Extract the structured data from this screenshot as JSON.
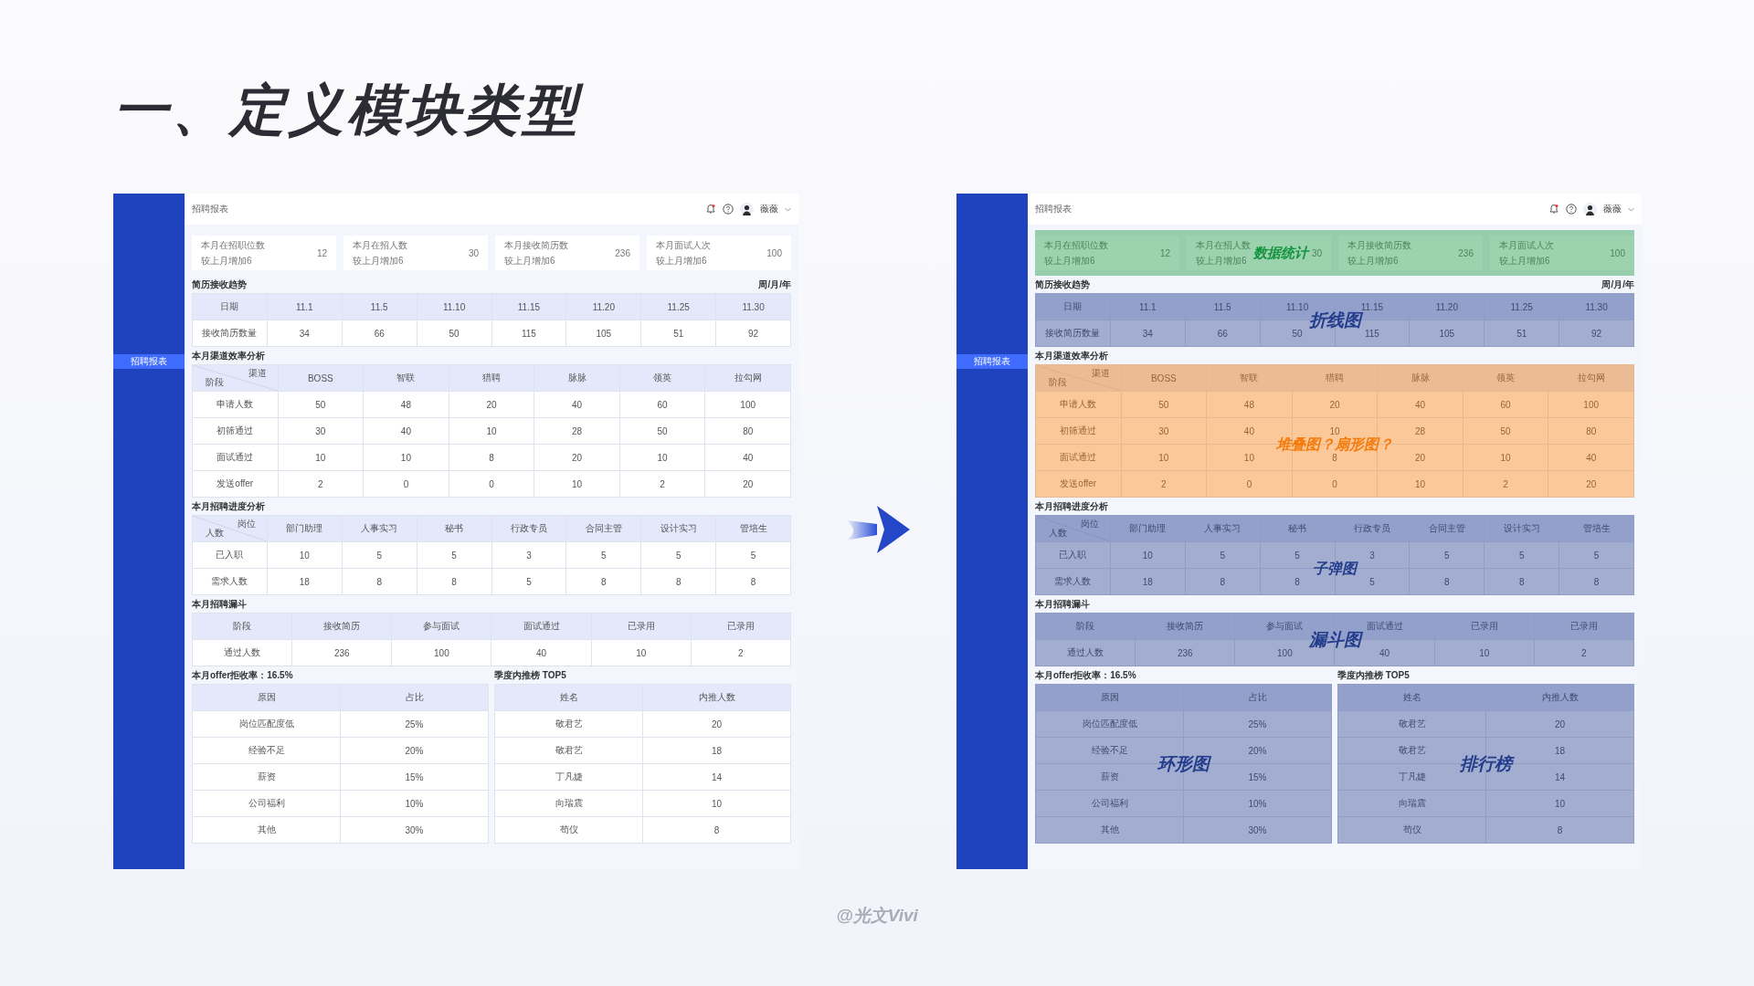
{
  "slide_title": "一、定义模块类型",
  "dashboards": [
    {
      "header": {
        "title": "招聘报表",
        "user": "薇薇"
      },
      "sidebar": {
        "items": [
          {
            "label": "招聘报表",
            "selected": true
          }
        ]
      },
      "stat_cards": {
        "cards": [
          {
            "label": "本月在招职位数",
            "change": "较上月增加6",
            "value": "12"
          },
          {
            "label": "本月在招人数",
            "change": "较上月增加6",
            "value": "30"
          },
          {
            "label": "本月接收简历数",
            "change": "较上月增加6",
            "value": "236"
          },
          {
            "label": "本月面试人次",
            "change": "较上月增加6",
            "value": "100"
          }
        ]
      },
      "sections": [
        {
          "title": "简历接收趋势",
          "extra": "周/月/年",
          "columns": [
            "日期",
            "11.1",
            "11.5",
            "11.10",
            "11.15",
            "11.20",
            "11.25",
            "11.30"
          ],
          "rows": [
            [
              "接收简历数量",
              "34",
              "66",
              "50",
              "115",
              "105",
              "51",
              "92"
            ]
          ]
        },
        {
          "title": "本月渠道效率分析",
          "columns": [
            {
              "top": "渠道",
              "bottom": "阶段"
            },
            "BOSS",
            "智联",
            "猎聘",
            "脉脉",
            "领英",
            "拉勾网"
          ],
          "rows": [
            [
              "申请人数",
              "50",
              "48",
              "20",
              "40",
              "60",
              "100"
            ],
            [
              "初筛通过",
              "30",
              "40",
              "10",
              "28",
              "50",
              "80"
            ],
            [
              "面试通过",
              "10",
              "10",
              "8",
              "20",
              "10",
              "40"
            ],
            [
              "发送offer",
              "2",
              "0",
              "0",
              "10",
              "2",
              "20"
            ]
          ]
        },
        {
          "title": "本月招聘进度分析",
          "columns": [
            {
              "top": "岗位",
              "bottom": "人数"
            },
            "部门助理",
            "人事实习",
            "秘书",
            "行政专员",
            "合同主管",
            "设计实习",
            "管培生"
          ],
          "rows": [
            [
              "已入职",
              "10",
              "5",
              "5",
              "3",
              "5",
              "5",
              "5"
            ],
            [
              "需求人数",
              "18",
              "8",
              "8",
              "5",
              "8",
              "8",
              "8"
            ]
          ]
        },
        {
          "title": "本月招聘漏斗",
          "columns": [
            "阶段",
            "接收简历",
            "参与面试",
            "面试通过",
            "已录用",
            "已录用"
          ],
          "rows": [
            [
              "通过人数",
              "236",
              "100",
              "40",
              "10",
              "2"
            ]
          ]
        }
      ],
      "split_sections": [
        {
          "title": "本月offer拒收率：16.5%",
          "columns": [
            "原因",
            "占比"
          ],
          "rows": [
            [
              "岗位匹配度低",
              "25%"
            ],
            [
              "经验不足",
              "20%"
            ],
            [
              "薪资",
              "15%"
            ],
            [
              "公司福利",
              "10%"
            ],
            [
              "其他",
              "30%"
            ]
          ]
        },
        {
          "title": "季度内推榜 TOP5",
          "columns": [
            "姓名",
            "内推人数"
          ],
          "rows": [
            [
              "敬君艺",
              "20"
            ],
            [
              "敬君艺",
              "18"
            ],
            [
              "丁凡婕",
              "14"
            ],
            [
              "向瑞震",
              "10"
            ],
            [
              "苟仪",
              "8"
            ]
          ]
        }
      ]
    },
    {
      "header": {
        "title": "招聘报表",
        "user": "薇薇"
      },
      "sidebar": {
        "items": [
          {
            "label": "招聘报表",
            "selected": true
          }
        ]
      },
      "stat_cards": {
        "cards": [
          {
            "label": "本月在招职位数",
            "change": "较上月增加6",
            "value": "12"
          },
          {
            "label": "本月在招人数",
            "change": "较上月增加6",
            "value": "30"
          },
          {
            "label": "本月接收简历数",
            "change": "较上月增加6",
            "value": "236"
          },
          {
            "label": "本月面试人次",
            "change": "较上月增加6",
            "value": "100"
          }
        ],
        "annotation": {
          "label": "数据统计",
          "color": "#14933f"
        }
      },
      "sections": [
        {
          "title": "简历接收趋势",
          "extra": "周/月/年",
          "columns": [
            "日期",
            "11.1",
            "11.5",
            "11.10",
            "11.15",
            "11.20",
            "11.25",
            "11.30"
          ],
          "rows": [
            [
              "接收简历数量",
              "34",
              "66",
              "50",
              "115",
              "105",
              "51",
              "92"
            ]
          ],
          "annotation": {
            "label": "折线图",
            "color": "#233c8c"
          }
        },
        {
          "title": "本月渠道效率分析",
          "columns": [
            {
              "top": "渠道",
              "bottom": "阶段"
            },
            "BOSS",
            "智联",
            "猎聘",
            "脉脉",
            "领英",
            "拉勾网"
          ],
          "rows": [
            [
              "申请人数",
              "50",
              "48",
              "20",
              "40",
              "60",
              "100"
            ],
            [
              "初筛通过",
              "30",
              "40",
              "10",
              "28",
              "50",
              "80"
            ],
            [
              "面试通过",
              "10",
              "10",
              "8",
              "20",
              "10",
              "40"
            ],
            [
              "发送offer",
              "2",
              "0",
              "0",
              "10",
              "2",
              "20"
            ]
          ],
          "annotation": {
            "label": "堆叠图？扇形图？",
            "color": "#f57c0c"
          }
        },
        {
          "title": "本月招聘进度分析",
          "columns": [
            {
              "top": "岗位",
              "bottom": "人数"
            },
            "部门助理",
            "人事实习",
            "秘书",
            "行政专员",
            "合同主管",
            "设计实习",
            "管培生"
          ],
          "rows": [
            [
              "已入职",
              "10",
              "5",
              "5",
              "3",
              "5",
              "5",
              "5"
            ],
            [
              "需求人数",
              "18",
              "8",
              "8",
              "5",
              "8",
              "8",
              "8"
            ]
          ],
          "annotation": {
            "label": "子弹图",
            "color": "#233c8c"
          }
        },
        {
          "title": "本月招聘漏斗",
          "columns": [
            "阶段",
            "接收简历",
            "参与面试",
            "面试通过",
            "已录用",
            "已录用"
          ],
          "rows": [
            [
              "通过人数",
              "236",
              "100",
              "40",
              "10",
              "2"
            ]
          ],
          "annotation": {
            "label": "漏斗图",
            "color": "#233c8c"
          }
        }
      ],
      "split_sections": [
        {
          "title": "本月offer拒收率：16.5%",
          "columns": [
            "原因",
            "占比"
          ],
          "rows": [
            [
              "岗位匹配度低",
              "25%"
            ],
            [
              "经验不足",
              "20%"
            ],
            [
              "薪资",
              "15%"
            ],
            [
              "公司福利",
              "10%"
            ],
            [
              "其他",
              "30%"
            ]
          ],
          "annotation": {
            "label": "环形图",
            "color": "#233c8c"
          }
        },
        {
          "title": "季度内推榜 TOP5",
          "columns": [
            "姓名",
            "内推人数"
          ],
          "rows": [
            [
              "敬君艺",
              "20"
            ],
            [
              "敬君艺",
              "18"
            ],
            [
              "丁凡婕",
              "14"
            ],
            [
              "向瑞震",
              "10"
            ],
            [
              "苟仪",
              "8"
            ]
          ],
          "annotation": {
            "label": "排行榜",
            "color": "#233c8c"
          }
        }
      ]
    }
  ],
  "credit": "@光文Vivi"
}
